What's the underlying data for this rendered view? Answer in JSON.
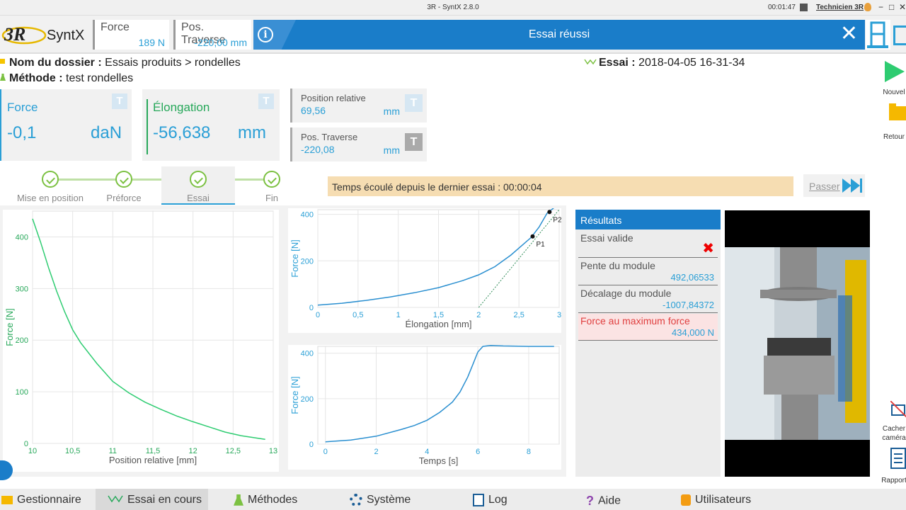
{
  "titlebar": {
    "title": "3R - SyntX 2.8.0",
    "time": "00:01:47",
    "user": "Technicien 3R",
    "min": "−",
    "max": "□",
    "close": "✕"
  },
  "app": {
    "logo_mark": "3R",
    "logo_text": "SyntX"
  },
  "topbar": {
    "force_label": "Force",
    "force_value": "189 N",
    "traverse_label": "Pos. Traverse",
    "traverse_value": "-220,00 mm"
  },
  "banner": {
    "message": "Essai réussi",
    "info_glyph": "i",
    "close_glyph": "✕"
  },
  "info": {
    "dossier_label": "Nom du dossier :",
    "dossier_value": "Essais produits > rondelles",
    "methode_label": "Méthode :",
    "methode_value": "test rondelles",
    "essai_label": "Essai :",
    "essai_value": "2018-04-05 16-31-34"
  },
  "tiles": {
    "force": {
      "label": "Force",
      "value": "-0,1",
      "unit": "daN"
    },
    "elongation": {
      "label": "Élongation",
      "value": "-56,638",
      "unit": "mm"
    },
    "posrel": {
      "label": "Position relative",
      "value": "69,56",
      "unit": "mm"
    },
    "postrav": {
      "label": "Pos. Traverse",
      "value": "-220,08",
      "unit": "mm"
    },
    "t_glyph": "T"
  },
  "steps": [
    {
      "label": "Mise en position"
    },
    {
      "label": "Préforce"
    },
    {
      "label": "Essai"
    },
    {
      "label": "Fin"
    }
  ],
  "elapsed": "Temps écoulé depuis le dernier essai : 00:00:04",
  "passer": "Passer",
  "results": {
    "header": "Résultats",
    "items": [
      {
        "label": "Essai valide",
        "value": "✖"
      },
      {
        "label": "Pente du module",
        "value": "492,06533"
      },
      {
        "label": "Décalage du module",
        "value": "-1007,84372"
      },
      {
        "label": "Force au maximum force",
        "value": "434,000 N"
      }
    ]
  },
  "rightbar": {
    "new_label": "Nouvel",
    "back_label": "Retour",
    "hide_label_1": "Cacher",
    "hide_label_2": "caméra",
    "report_label": "Rapport"
  },
  "bottom_nav": [
    {
      "label": "Gestionnaire"
    },
    {
      "label": "Essai en cours"
    },
    {
      "label": "Méthodes"
    },
    {
      "label": "Système"
    },
    {
      "label": "Log"
    },
    {
      "label": "Aide"
    },
    {
      "label": "Utilisateurs"
    }
  ],
  "colors": {
    "accent": "#1a7dc9",
    "value": "#2a9fd6",
    "green": "#7cc142",
    "chart_green": "#2ecc71",
    "chart_blue": "#2a8fd0"
  },
  "chart_data": [
    {
      "type": "line",
      "xlabel": "Position relative [mm]",
      "ylabel": "Force [N]",
      "xlim": [
        10,
        13
      ],
      "ylim": [
        0,
        450
      ],
      "xticks": [
        "10",
        "10,5",
        "11",
        "11,5",
        "12",
        "12,5",
        "13"
      ],
      "yticks": [
        "0",
        "100",
        "200",
        "300",
        "400"
      ],
      "series": [
        {
          "x": [
            10.0,
            10.1,
            10.2,
            10.3,
            10.4,
            10.5,
            10.6,
            10.8,
            11.0,
            11.2,
            11.4,
            11.6,
            11.8,
            12.0,
            12.2,
            12.4,
            12.6,
            12.9
          ],
          "y": [
            435,
            390,
            340,
            295,
            255,
            220,
            195,
            155,
            120,
            98,
            80,
            66,
            53,
            42,
            32,
            22,
            15,
            8
          ]
        }
      ]
    },
    {
      "type": "line",
      "xlabel": "Élongation [mm]",
      "ylabel": "Force [N]",
      "xlim": [
        0,
        3
      ],
      "ylim": [
        0,
        420
      ],
      "xticks": [
        "0",
        "0,5",
        "1",
        "1,5",
        "2",
        "2,5",
        "3"
      ],
      "yticks": [
        "0",
        "200",
        "400"
      ],
      "series": [
        {
          "x": [
            0,
            0.3,
            0.6,
            0.9,
            1.2,
            1.5,
            1.8,
            2.0,
            2.2,
            2.4,
            2.55,
            2.65,
            2.75,
            2.85,
            2.95
          ],
          "y": [
            10,
            18,
            30,
            45,
            63,
            85,
            115,
            140,
            175,
            225,
            270,
            300,
            345,
            405,
            470
          ]
        }
      ],
      "points": [
        {
          "label": "P1",
          "x": 2.67,
          "y": 305
        },
        {
          "label": "P2",
          "x": 2.88,
          "y": 410
        }
      ],
      "modulus_line": {
        "x": [
          2.0,
          3.0
        ],
        "y": [
          0,
          480
        ]
      }
    },
    {
      "type": "line",
      "xlabel": "Temps [s]",
      "ylabel": "Force [N]",
      "xlim": [
        -0.3,
        9.2
      ],
      "ylim": [
        0,
        430
      ],
      "xticks": [
        "0",
        "2",
        "4",
        "6",
        "8"
      ],
      "yticks": [
        "0",
        "200",
        "400"
      ],
      "series": [
        {
          "x": [
            0,
            1,
            2,
            3,
            3.5,
            4,
            4.5,
            5,
            5.3,
            5.6,
            5.8,
            6.0,
            6.2,
            6.5,
            7,
            8,
            9
          ],
          "y": [
            10,
            18,
            35,
            65,
            82,
            105,
            140,
            185,
            230,
            295,
            350,
            405,
            430,
            434,
            432,
            430,
            430
          ]
        }
      ]
    }
  ]
}
